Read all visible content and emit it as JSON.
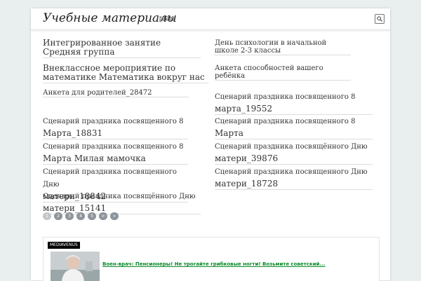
{
  "header": {
    "site_title": "Учебные материалы",
    "map_link": "карта",
    "search_icon": "search-icon"
  },
  "articles": [
    {
      "title": "Интегрированное занятие Средняя группа"
    },
    {
      "title": "День психологии в начальной школе 2-3 классы"
    },
    {
      "title": "Внеклассное мероприятие по математике Математика вокруг нас"
    },
    {
      "title": "Анкета способностей вашего ребёнка"
    },
    {
      "title": "Анкета для родителей_28472"
    },
    {
      "title": "Сценарий праздника посвященного 8",
      "title_rest": "марта_19552"
    },
    {
      "title": "Сценарий праздника посвященного 8",
      "title_rest": "Марта_18831"
    },
    {
      "title": "Сценарий праздника посвященного 8",
      "title_rest": "Марта"
    },
    {
      "title": "Сценарий праздника посвященного 8",
      "title_rest": "Марта Милая мамочка"
    },
    {
      "title": "Сценарий праздника посвящённого Дню",
      "title_rest": "матери_39876"
    },
    {
      "title": "Сценарий праздника посвященного Дню",
      "title_rest": "матери_18842"
    },
    {
      "title": "Сценарий праздника посвященного Дню",
      "title_rest": "матери_18728"
    },
    {
      "title": "Сценарий праздника посвящённого Дню",
      "title_rest": "матери_15141"
    }
  ],
  "pagination": {
    "pages": [
      "1",
      "2",
      "3",
      "4",
      "5"
    ],
    "next": ">",
    "last": "»",
    "current": "1"
  },
  "ad": {
    "brand": "MEDIAVENUS",
    "link_text": "Воен-врач: Пенсионеры! Не трогайте грибковые ногти! Возьмите советский..."
  },
  "colors": {
    "background": "#e9eeee",
    "pager": "#8f959c",
    "ad_link": "#0a8a2a"
  }
}
